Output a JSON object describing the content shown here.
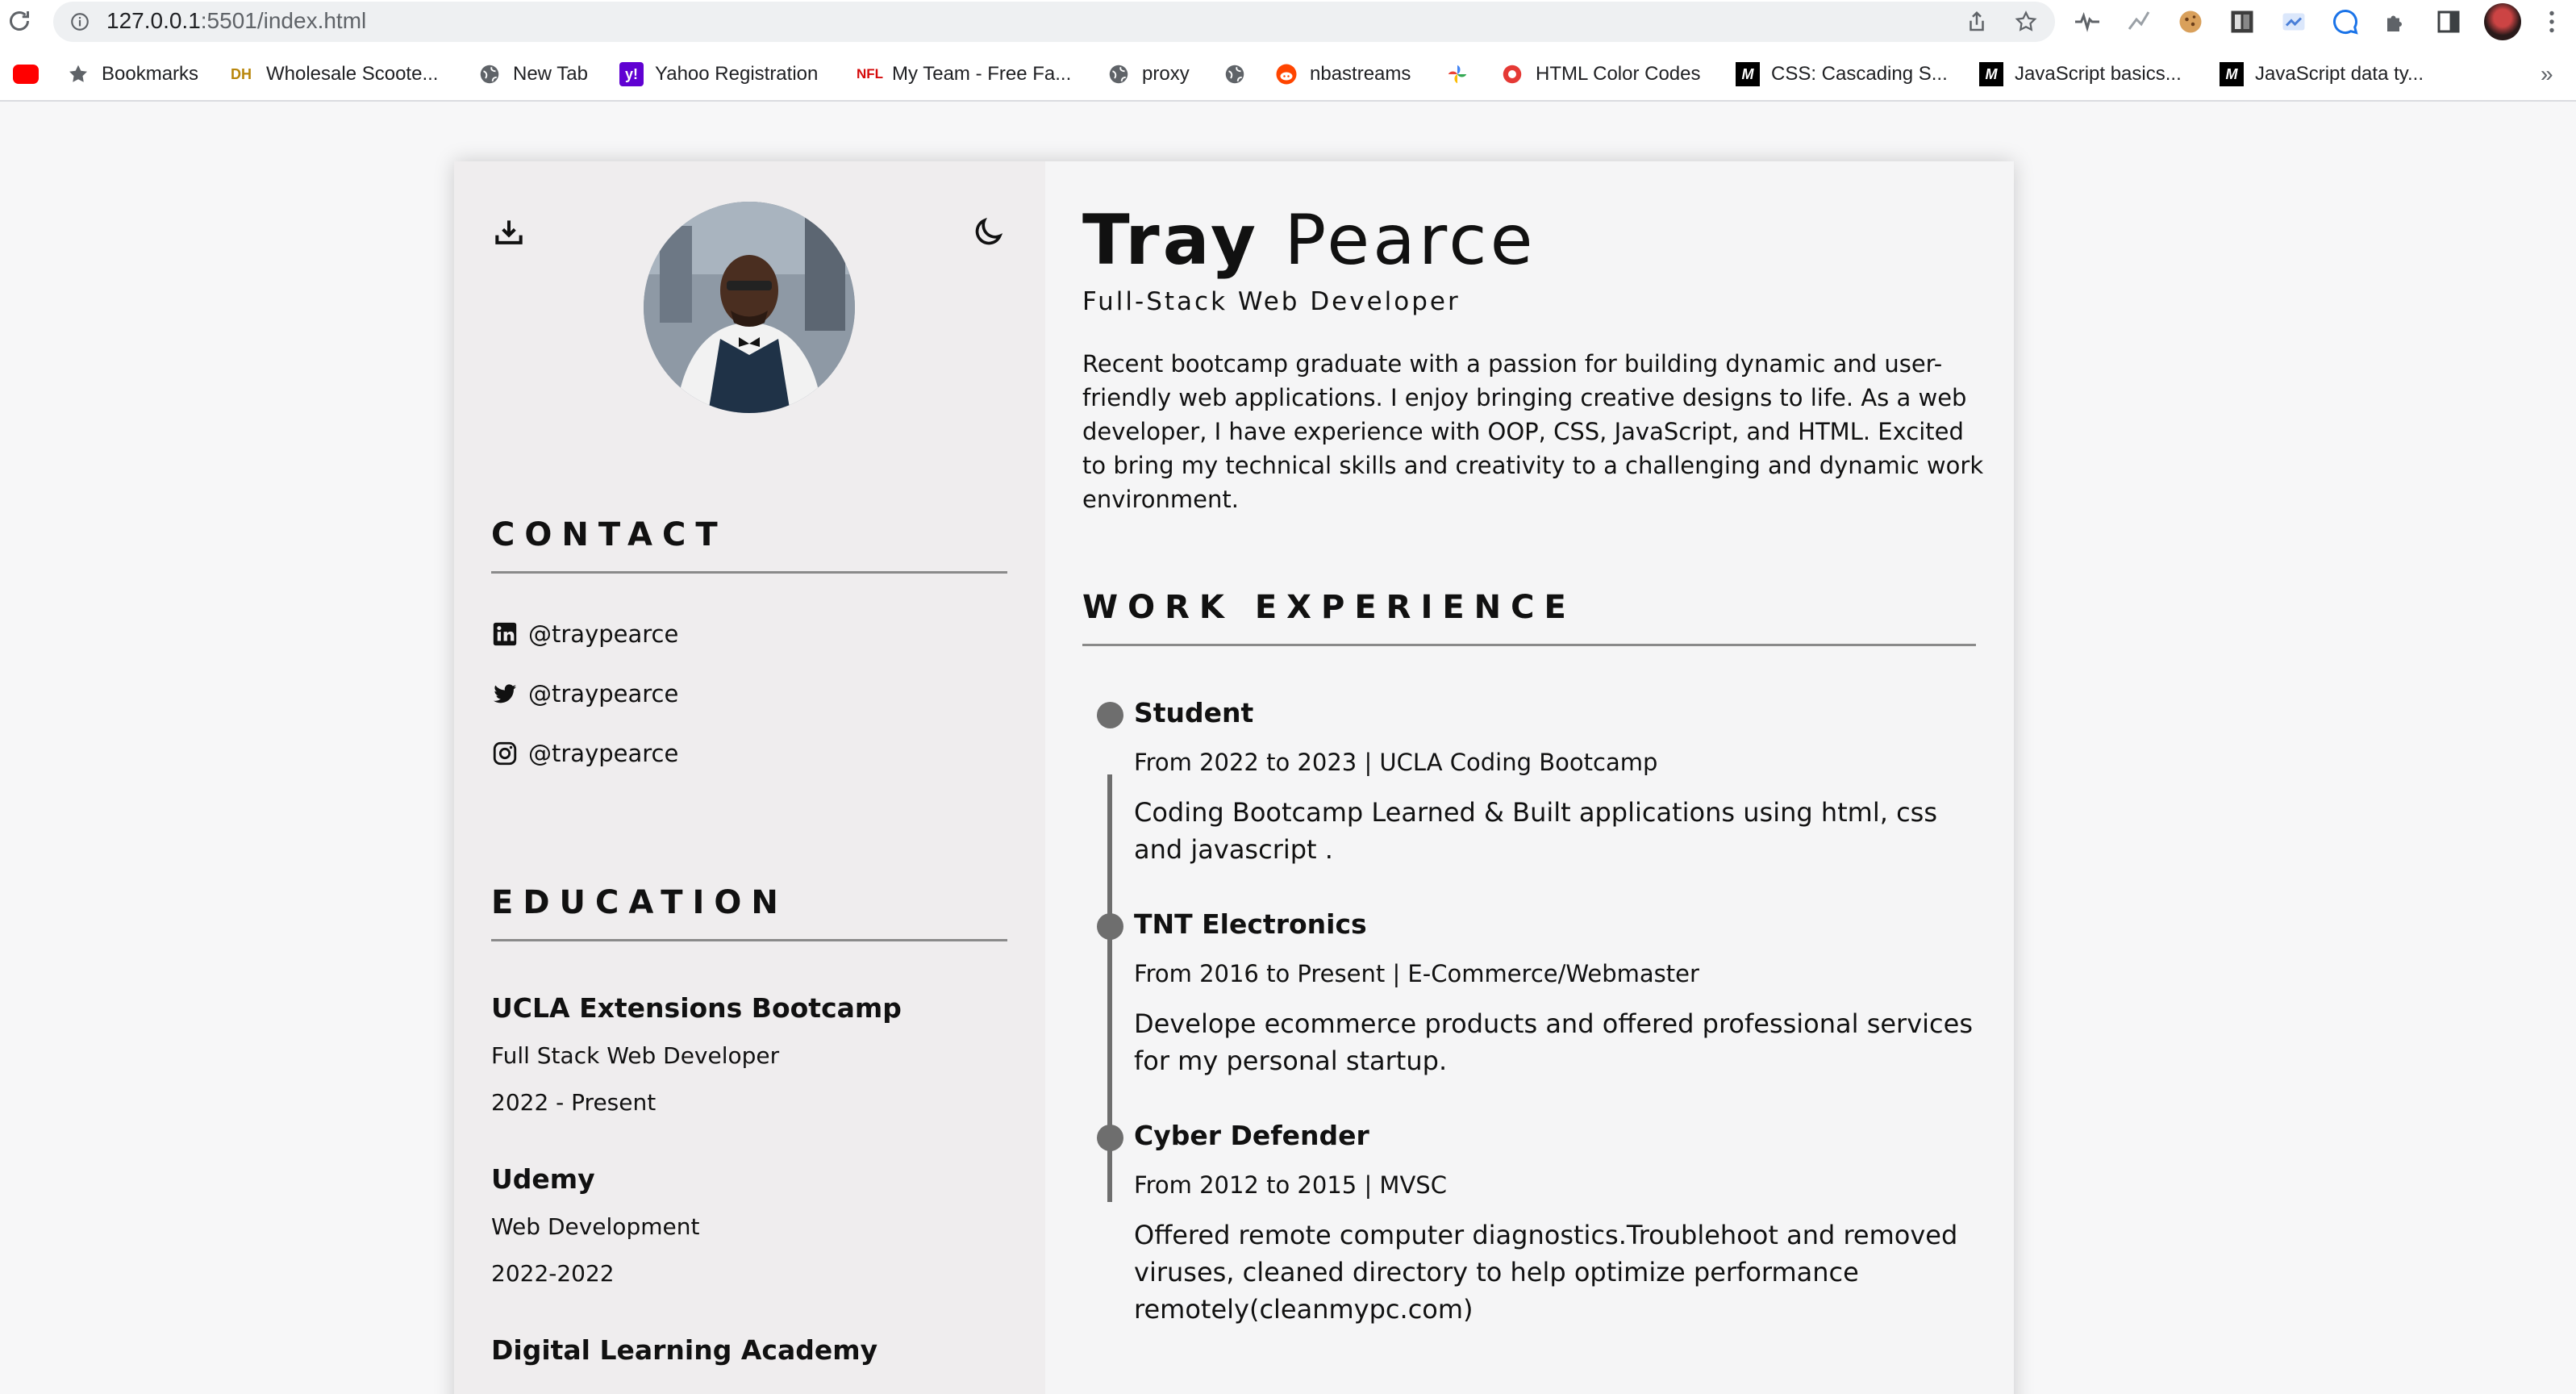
{
  "browser": {
    "url_host": "127.0.0.1",
    "url_rest": ":5501/index.html",
    "bookmarks": [
      {
        "icon": "youtube-icon",
        "label": ""
      },
      {
        "icon": "star-icon",
        "label": "Bookmarks"
      },
      {
        "icon": "dh-icon",
        "label": "Wholesale Scoote..."
      },
      {
        "icon": "globe-icon",
        "label": "New Tab"
      },
      {
        "icon": "yahoo-icon",
        "label": "Yahoo Registration"
      },
      {
        "icon": "nfl-icon",
        "label": "My Team - Free Fa..."
      },
      {
        "icon": "globe-icon",
        "label": "proxy"
      },
      {
        "icon": "globe-icon",
        "label": ""
      },
      {
        "icon": "reddit-icon",
        "label": "nbastreams"
      },
      {
        "icon": "pinwheel-icon",
        "label": ""
      },
      {
        "icon": "color-codes-icon",
        "label": "HTML Color Codes"
      },
      {
        "icon": "mdn-icon",
        "label": "CSS: Cascading S..."
      },
      {
        "icon": "mdn-icon",
        "label": "JavaScript basics..."
      },
      {
        "icon": "mdn-icon",
        "label": "JavaScript data ty..."
      }
    ],
    "overflow_label": "»"
  },
  "profile": {
    "first_name": "Tray",
    "last_name": "Pearce",
    "role": "Full-Stack Web Developer",
    "summary": "Recent bootcamp graduate with a passion for building dynamic and user-friendly web applications. I enjoy bringing creative designs to life. As a web developer, I have experience with OOP, CSS, JavaScript, and HTML. Excited to bring my technical skills and creativity to a challenging and dynamic work environment."
  },
  "contact": {
    "title": "CONTACT",
    "items": [
      {
        "icon": "linkedin-icon",
        "handle": "@traypearce"
      },
      {
        "icon": "twitter-icon",
        "handle": "@traypearce"
      },
      {
        "icon": "instagram-icon",
        "handle": "@traypearce"
      }
    ]
  },
  "education": {
    "title": "EDUCATION",
    "items": [
      {
        "school": "UCLA Extensions Bootcamp",
        "program": "Full Stack Web Developer",
        "dates": "2022 - Present"
      },
      {
        "school": "Udemy",
        "program": "Web Development",
        "dates": "2022-2022"
      },
      {
        "school": "Digital Learning Academy"
      }
    ]
  },
  "work": {
    "title": "WORK EXPERIENCE",
    "items": [
      {
        "title": "Student",
        "meta": "From 2022 to 2023 | UCLA Coding Bootcamp",
        "desc": "Coding Bootcamp Learned & Built applications using html, css and javascript ."
      },
      {
        "title": "TNT Electronics",
        "meta": "From 2016 to Present | E-Commerce/Webmaster",
        "desc": "Develope ecommerce products and offered professional services for my personal startup."
      },
      {
        "title": "Cyber Defender",
        "meta": "From 2012 to 2015 | MVSC",
        "desc": "Offered remote computer diagnostics.Troublehoot and removed viruses, cleaned directory to help optimize performance remotely(cleanmypc.com)"
      }
    ]
  },
  "colors": {
    "left_panel": "#efedee",
    "right_panel": "#f5f5f6",
    "timeline": "#6e6e6e",
    "text": "#111111"
  }
}
